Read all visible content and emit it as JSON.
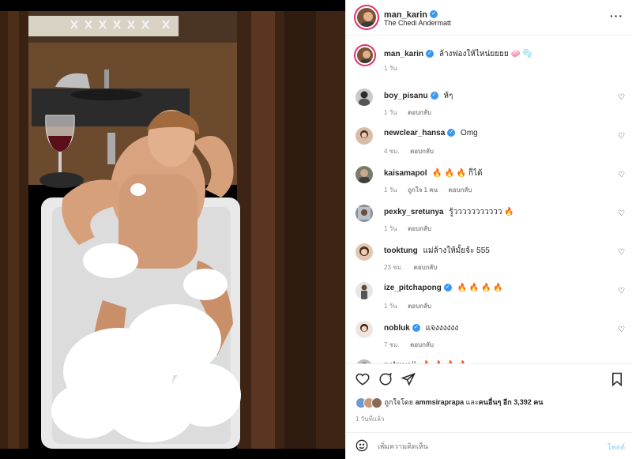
{
  "header": {
    "username": "man_karin",
    "location": "The Chedi Andermatt",
    "more_icon": "more-horizontal-icon"
  },
  "caption": {
    "username": "man_karin",
    "text": "ล้างฟองให้ไหน่ยยยย 🧼 🫧",
    "time": "1 วัน"
  },
  "comments": [
    {
      "username": "boy_pisanu",
      "verified": true,
      "text": "ห้ๆ",
      "time": "1 วัน",
      "likes": "",
      "reply": "ตอบกลับ"
    },
    {
      "username": "newclear_hansa",
      "verified": true,
      "text": "Omg",
      "time": "4 ชม.",
      "likes": "",
      "reply": "ตอบกลับ"
    },
    {
      "username": "kaisamapol",
      "verified": false,
      "text": "🔥 🔥 🔥 ก็ได้",
      "time": "1 วัน",
      "likes": "ถูกใจ 1 คน",
      "reply": "ตอบกลับ"
    },
    {
      "username": "pexky_sretunya",
      "verified": false,
      "text": "รู้ววววววววววว 🔥",
      "time": "1 วัน",
      "likes": "",
      "reply": "ตอบกลับ"
    },
    {
      "username": "tooktung",
      "verified": false,
      "text": "แม่ล้างให้มั้ยจ้ะ 555",
      "time": "23 ชม.",
      "likes": "",
      "reply": "ตอบกลับ"
    },
    {
      "username": "ize_pitchapong",
      "verified": true,
      "text": "🔥 🔥 🔥 🔥",
      "time": "1 วัน",
      "likes": "",
      "reply": "ตอบกลับ"
    },
    {
      "username": "nobluk",
      "verified": true,
      "text": "แจงงงงงง",
      "time": "7 ชม.",
      "likes": "",
      "reply": "ตอบกลับ"
    },
    {
      "username": "palmyoii",
      "verified": false,
      "text": "🔥 🔥 🔥 🔥",
      "time": "",
      "likes": "",
      "reply": ""
    }
  ],
  "actions": {
    "like_icon": "heart-icon",
    "comment_icon": "comment-icon",
    "share_icon": "send-icon",
    "save_icon": "bookmark-icon"
  },
  "likes": {
    "prefix": "ถูกใจโดย",
    "user": "ammsiraprapa",
    "middle": "และ",
    "others": "คนอื่นๆ อีก 3,392 คน"
  },
  "time_ago": "1 วันที่แล้ว",
  "comment_input": {
    "placeholder": "เพิ่มความคิดเห็น",
    "post_label": "โพสต์"
  },
  "colors": {
    "verified": "#3897f0",
    "muted": "#8e8e8e",
    "post_disabled": "#b2dffc",
    "story_ring": "#e1306c"
  }
}
